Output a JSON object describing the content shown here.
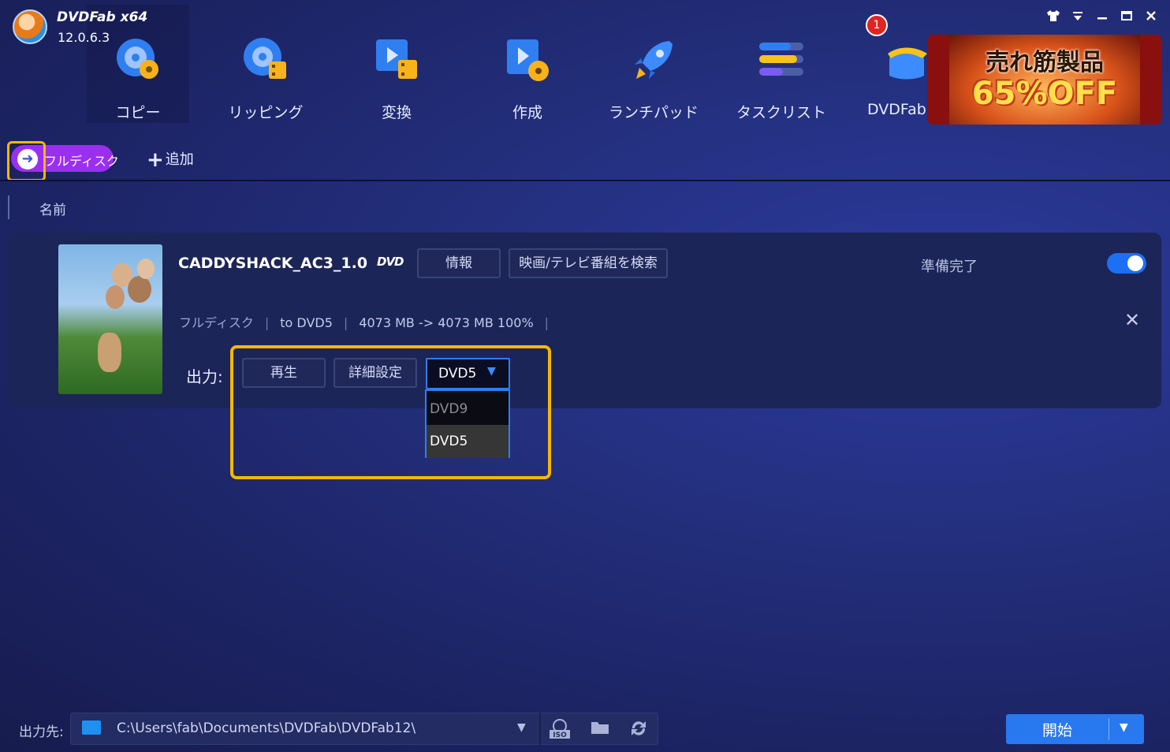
{
  "app": {
    "name": "DVDFab x64",
    "version": "12.0.6.3"
  },
  "modules": [
    {
      "label": "コピー",
      "icon": "copy-disc-icon"
    },
    {
      "label": "リッピング",
      "icon": "ripper-icon"
    },
    {
      "label": "変換",
      "icon": "converter-icon"
    },
    {
      "label": "作成",
      "icon": "creator-icon"
    },
    {
      "label": "ランチパッド",
      "icon": "launchpad-rocket-icon"
    },
    {
      "label": "タスクリスト",
      "icon": "tasklist-icon"
    },
    {
      "label": "DVDFab",
      "icon": "dvdfab-hat-icon"
    }
  ],
  "notification_count": "1",
  "ad": {
    "line1": "売れ筋製品",
    "line2": "65%OFF"
  },
  "toolbar": {
    "mode_label": "フルディスク",
    "add_label": "追加"
  },
  "list_header": {
    "name_col": "名前"
  },
  "task": {
    "title": "CADDYSHACK_AC3_1.0",
    "disc_badge": "DVD",
    "info_btn": "情報",
    "search_btn": "映画/テレビ番組を検索",
    "status": "準備完了",
    "enabled": true,
    "meta": {
      "mode": "フルディスク",
      "target": "to DVD5",
      "size": "4073 MB -> 4073 MB 100%"
    },
    "output_label": "出力:",
    "play_btn": "再生",
    "settings_btn": "詳細設定",
    "output_select": {
      "value": "DVD5",
      "options": [
        "DVD9",
        "DVD5"
      ]
    }
  },
  "footer": {
    "dest_label": "出力先:",
    "dest_path": "C:\\Users\\fab\\Documents\\DVDFab\\DVDFab12\\",
    "start_label": "開始"
  },
  "colors": {
    "accent_blue": "#2879f0",
    "mode_purple": "#9b2ff0",
    "highlight": "#f5b800"
  }
}
